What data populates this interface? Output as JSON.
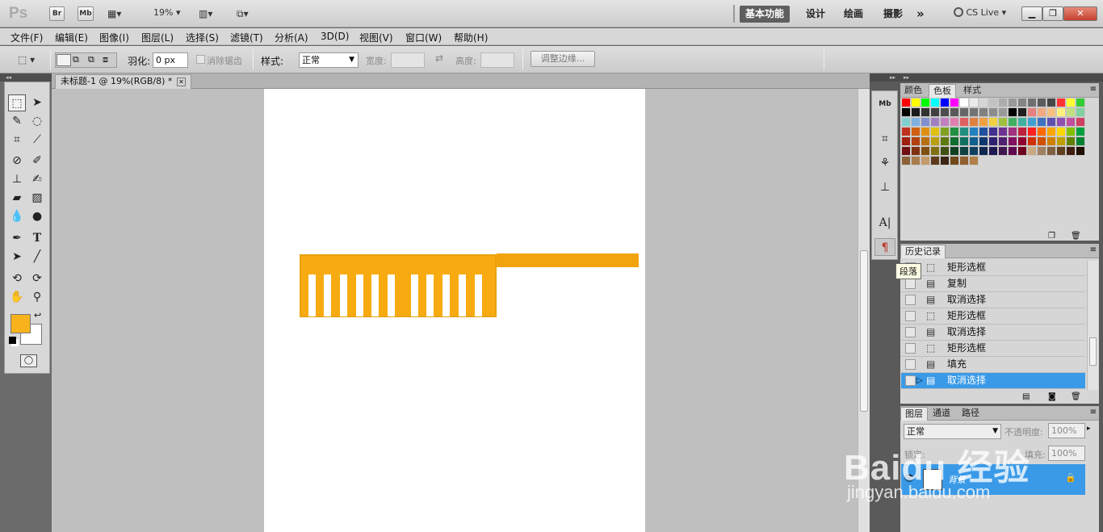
{
  "app": {
    "logo": "Ps",
    "bridge_label": "Br",
    "minibridge_label": "Mb",
    "zoom": "19%",
    "workspaces": [
      "基本功能",
      "设计",
      "绘画",
      "摄影"
    ],
    "more": "»",
    "cs_live": "CS Live"
  },
  "menu": [
    "文件(F)",
    "编辑(E)",
    "图像(I)",
    "图层(L)",
    "选择(S)",
    "滤镜(T)",
    "分析(A)",
    "3D(D)",
    "视图(V)",
    "窗口(W)",
    "帮助(H)"
  ],
  "options": {
    "feather_label": "羽化:",
    "feather_value": "0 px",
    "antialias_label": "消除锯齿",
    "style_label": "样式:",
    "style_value": "正常",
    "width_label": "宽度:",
    "height_label": "高度:",
    "refine_edge": "调整边缘..."
  },
  "document": {
    "tab_title": "未标题-1 @ 19%(RGB/8) *",
    "comb_color": "#f7ab10",
    "comb_edge": "#e9a20c"
  },
  "colors": {
    "foreground": "#f7b21c",
    "background": "#ffffff",
    "selection": "#3a9ae8"
  },
  "swatches_panel": {
    "tabs": [
      "颜色",
      "色板",
      "样式"
    ],
    "active_tab": "色板",
    "swatches": [
      "#ff0000",
      "#ffff00",
      "#00ff00",
      "#00ffff",
      "#0000ff",
      "#ff00ff",
      "#ffffff",
      "#ebebeb",
      "#d6d6d6",
      "#c2c2c2",
      "#adadad",
      "#999999",
      "#858585",
      "#707070",
      "#5c5c5c",
      "#474747",
      "#ff3333",
      "#ffff33",
      "#33cc33",
      "#000000",
      "#1a1a1a",
      "#333333",
      "#404040",
      "#4d4d4d",
      "#5a5a5a",
      "#666666",
      "#737373",
      "#808080",
      "#8c8c8c",
      "#999999",
      "#000000",
      "#1f1f1f",
      "#e68080",
      "#f2a880",
      "#f7c080",
      "#fff080",
      "#c0e080",
      "#80d0a0",
      "#80d0d0",
      "#80b0e0",
      "#8090d0",
      "#a080c0",
      "#c080c0",
      "#e080b0",
      "#e06060",
      "#e08040",
      "#f0a040",
      "#f0d040",
      "#a0c040",
      "#40b060",
      "#40b0a0",
      "#40a0d0",
      "#4070c0",
      "#6050b0",
      "#9050b0",
      "#c050a0",
      "#d04060",
      "#c03020",
      "#d06010",
      "#e09010",
      "#e0c010",
      "#80a020",
      "#209040",
      "#209080",
      "#2080c0",
      "#2050a0",
      "#403090",
      "#703090",
      "#a03080",
      "#c02040",
      "#ff2020",
      "#ff6a00",
      "#ffa500",
      "#ffd700",
      "#80c000",
      "#00a040",
      "#a02010",
      "#b04010",
      "#b87010",
      "#b8a010",
      "#607a10",
      "#107030",
      "#107060",
      "#106090",
      "#103870",
      "#302070",
      "#502070",
      "#801060",
      "#900030",
      "#d03000",
      "#d05000",
      "#d08000",
      "#c0a000",
      "#608000",
      "#008030",
      "#701010",
      "#803010",
      "#805010",
      "#807010",
      "#405010",
      "#104020",
      "#104040",
      "#104060",
      "#102850",
      "#201850",
      "#401850",
      "#600850",
      "#700020",
      "#c8a880",
      "#a08060",
      "#806040",
      "#604020",
      "#402010",
      "#201000",
      "#8c6238",
      "#a87c4e",
      "#c49a6a",
      "#5c3c1c",
      "#3c2414",
      "#704818",
      "#906030",
      "#b08048"
    ]
  },
  "history_panel": {
    "title": "历史记录",
    "items": [
      {
        "label": "矩形选框",
        "icon": "marquee"
      },
      {
        "label": "复制",
        "icon": "doc"
      },
      {
        "label": "取消选择",
        "icon": "doc"
      },
      {
        "label": "矩形选框",
        "icon": "marquee"
      },
      {
        "label": "取消选择",
        "icon": "doc"
      },
      {
        "label": "矩形选框",
        "icon": "marquee"
      },
      {
        "label": "填充",
        "icon": "doc"
      },
      {
        "label": "取消选择",
        "icon": "doc",
        "selected": true
      }
    ]
  },
  "tooltip": "段落",
  "layers_panel": {
    "tabs": [
      "图层",
      "通道",
      "路径"
    ],
    "blend_mode": "正常",
    "opacity_label": "不透明度:",
    "opacity_value": "100%",
    "lock_label": "锁定:",
    "fill_label": "填充:",
    "fill_value": "100%",
    "layer_name": "背景"
  },
  "watermark": {
    "line1": "Baidu 经验",
    "line2": "jingyan.baidu.com"
  }
}
